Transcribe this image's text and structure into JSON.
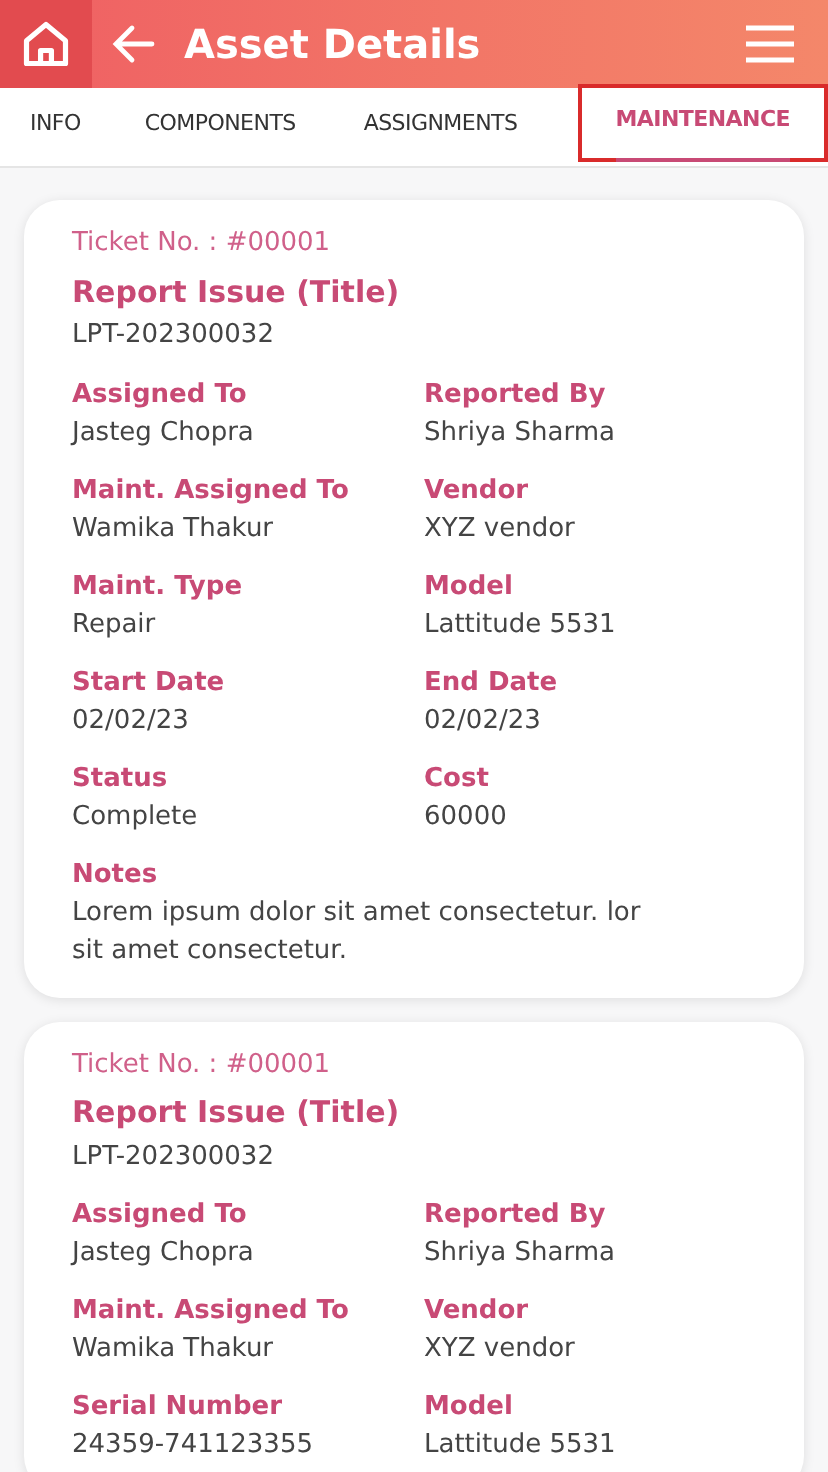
{
  "header": {
    "title": "Asset Details"
  },
  "tabs": [
    {
      "label": "INFO",
      "selected": false,
      "highlighted": false
    },
    {
      "label": "COMPONENTS",
      "selected": false,
      "highlighted": false
    },
    {
      "label": "ASSIGNMENTS",
      "selected": false,
      "highlighted": false
    },
    {
      "label": "MAINTENANCE",
      "selected": true,
      "highlighted": true
    }
  ],
  "tickets": [
    {
      "ticket_no": "Ticket No. : #00001",
      "title": "Report Issue (Title)",
      "asset_code": "LPT-202300032",
      "fields": [
        {
          "kind": "half",
          "label": "Assigned To",
          "value": "Jasteg Chopra"
        },
        {
          "kind": "half",
          "label": "Reported By",
          "value": "Shriya Sharma"
        },
        {
          "kind": "half",
          "label": "Maint. Assigned To",
          "value": "Wamika Thakur"
        },
        {
          "kind": "half",
          "label": "Vendor",
          "value": "XYZ vendor"
        },
        {
          "kind": "half",
          "label": "Maint. Type",
          "value": "Repair"
        },
        {
          "kind": "half",
          "label": "Model",
          "value": "Lattitude 5531"
        },
        {
          "kind": "half",
          "label": "Start Date",
          "value": "02/02/23"
        },
        {
          "kind": "half",
          "label": "End Date",
          "value": "02/02/23"
        },
        {
          "kind": "half",
          "label": "Status",
          "value": "Complete"
        },
        {
          "kind": "half",
          "label": "Cost",
          "value": "60000"
        },
        {
          "kind": "full",
          "label": "Notes",
          "value": "Lorem ipsum dolor sit amet consectetur. lor sit amet consectetur."
        }
      ]
    },
    {
      "ticket_no": "Ticket No. : #00001",
      "title": "Report Issue (Title)",
      "asset_code": "LPT-202300032",
      "fields": [
        {
          "kind": "half",
          "label": "Assigned To",
          "value": "Jasteg Chopra"
        },
        {
          "kind": "half",
          "label": "Reported By",
          "value": "Shriya Sharma"
        },
        {
          "kind": "half",
          "label": "Maint. Assigned To",
          "value": "Wamika Thakur"
        },
        {
          "kind": "half",
          "label": "Vendor",
          "value": "XYZ vendor"
        },
        {
          "kind": "half",
          "label": "Serial Number",
          "value": "24359-741123355"
        },
        {
          "kind": "half",
          "label": "Model",
          "value": "Lattitude 5531"
        }
      ]
    }
  ]
}
